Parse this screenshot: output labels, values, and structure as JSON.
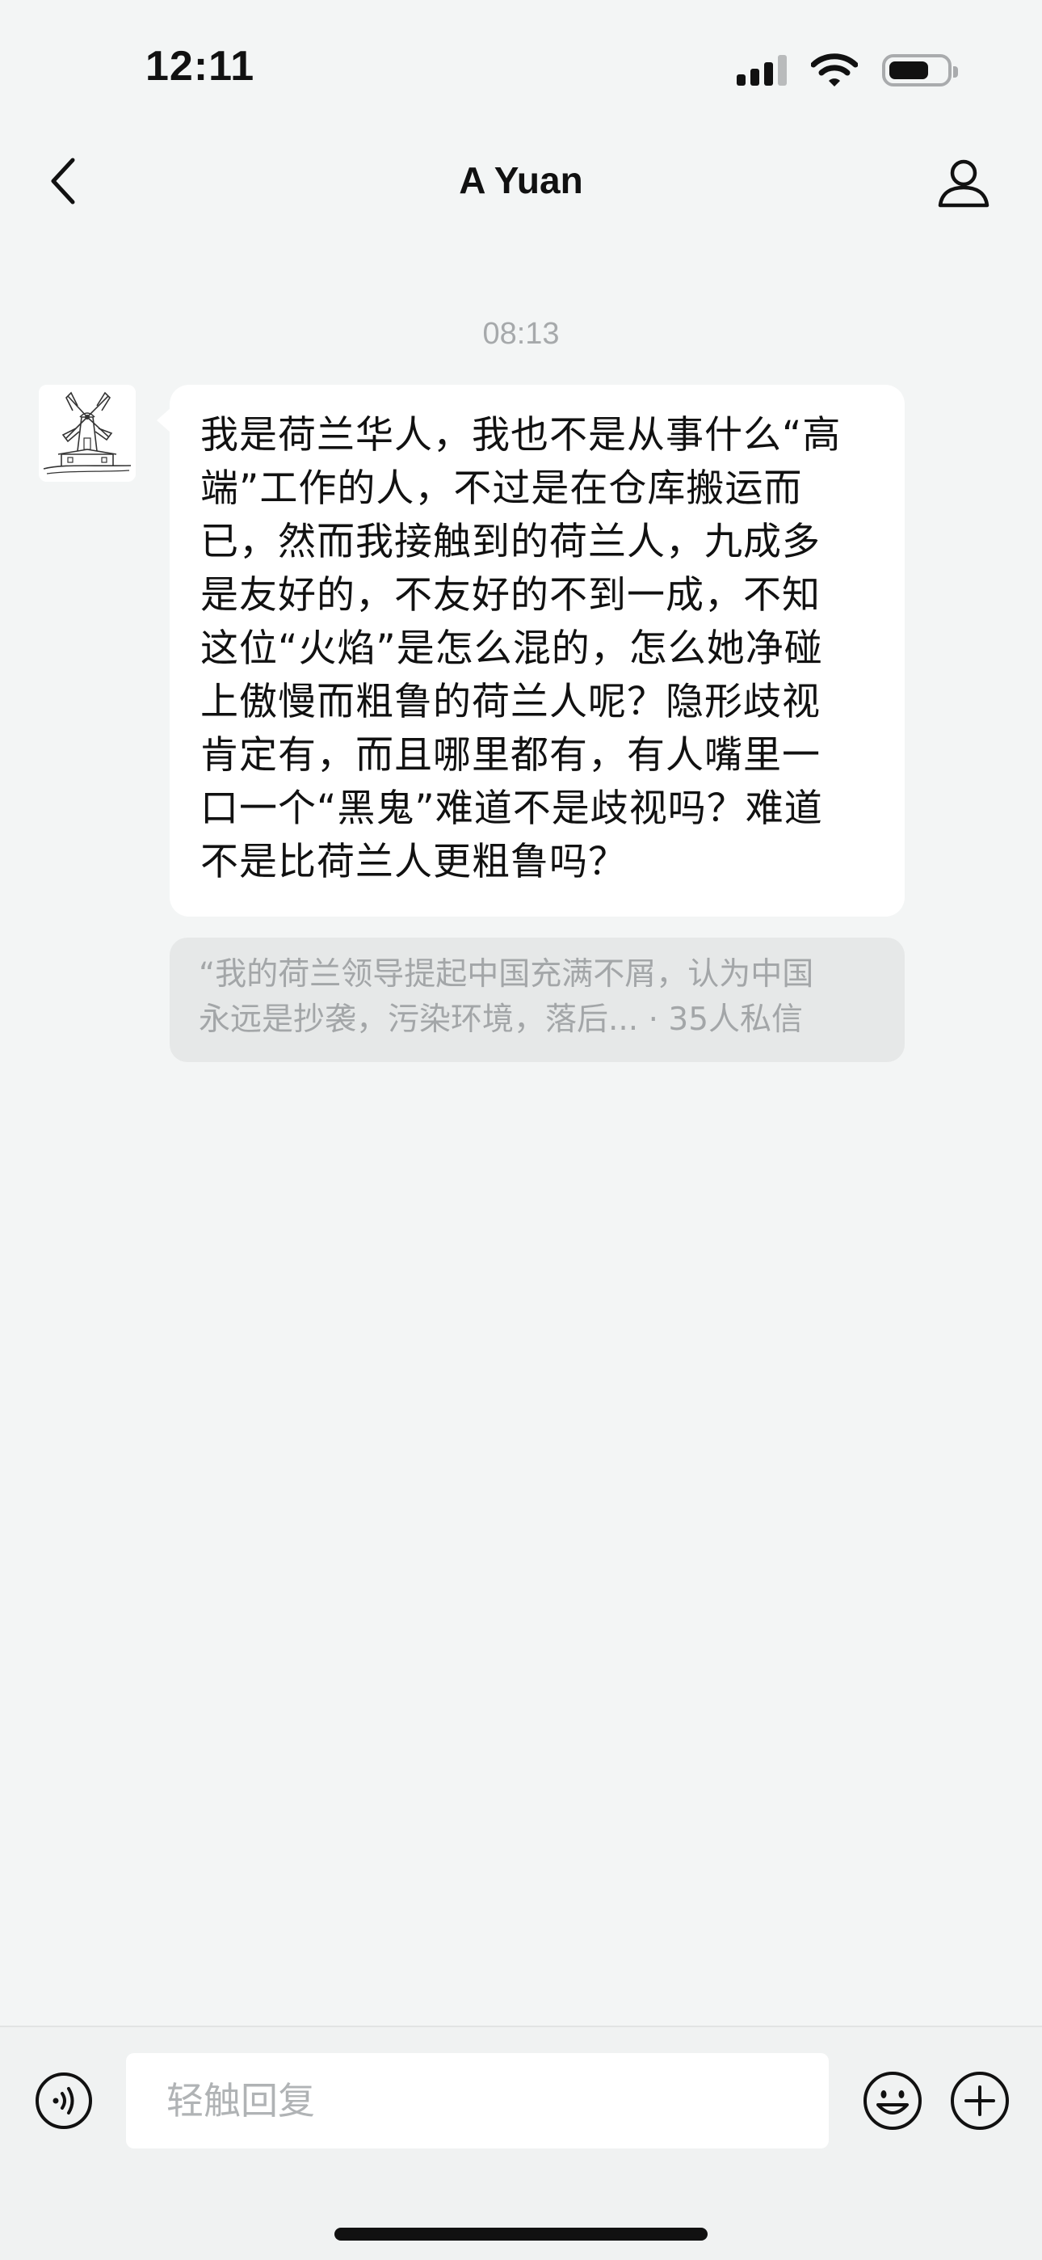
{
  "status_bar": {
    "time": "12:11"
  },
  "nav": {
    "title": "A Yuan",
    "back_icon": "chevron-left-icon",
    "profile_icon": "person-icon"
  },
  "chat": {
    "timestamp": "08:13",
    "message": {
      "sender_avatar": "windmill-avatar",
      "lines": [
        "我是荷兰华人，我也不是从事什么“高",
        "端”工作的人，不过是在仓库搬运而",
        "已，然而我接触到的荷兰人，九成多",
        "是友好的，不友好的不到一成，不知",
        "这位“火焰”是怎么混的，怎么她净碰",
        "上傲慢而粗鲁的荷兰人呢？隐形歧视",
        "肯定有，而且哪里都有，有人嘴里一",
        "口一个“黑鬼”难道不是歧视吗？难道",
        "不是比荷兰人更粗鲁吗？"
      ]
    },
    "quote": {
      "line1": "“我的荷兰领导提起中国充满不屑，认为中国",
      "line2": "永远是抄袭，污染环境，落后... · 35人私信"
    }
  },
  "input_bar": {
    "placeholder": "轻触回复",
    "voice_icon": "voice-icon",
    "emoji_icon": "emoji-icon",
    "plus_icon": "plus-icon"
  }
}
